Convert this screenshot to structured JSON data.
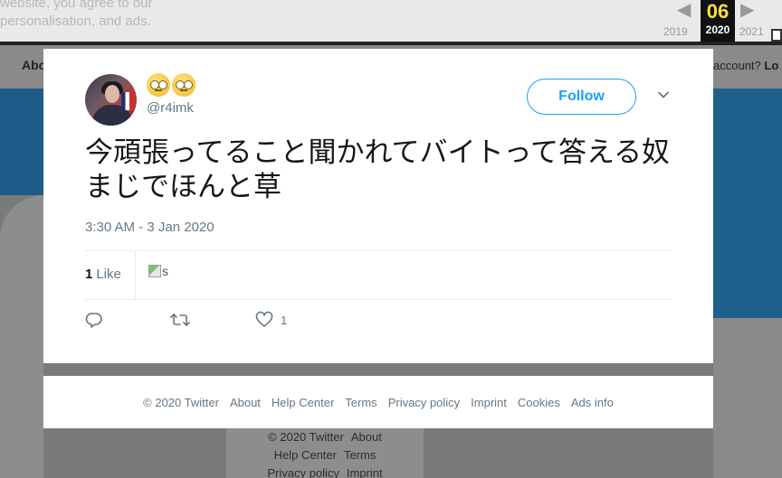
{
  "background": {
    "consent_line1": "website, you agree to our",
    "consent_line2": "personalisation, and ads.",
    "nav_about": "Abo",
    "nav_account": "account?",
    "nav_login": "Lo",
    "footer_items": [
      "© 2020 Twitter",
      "About",
      "Help Center",
      "Terms",
      "Privacy policy",
      "Imprint"
    ]
  },
  "wayback": {
    "prev_year": "2019",
    "day": "06",
    "current_year": "2020",
    "next_year": "2021"
  },
  "tweet": {
    "display_name_emoji": [
      "face-with-rolling-eyes",
      "face-with-rolling-eyes"
    ],
    "handle": "@r4imk",
    "follow_label": "Follow",
    "text": "今頑張ってること聞かれてバイトって答える奴まじでほんと草",
    "timestamp": "3:30 AM - 3 Jan 2020",
    "likes_count": "1",
    "likes_label": "Like",
    "liker_alt": "s",
    "action_like_count": "1",
    "icons": [
      "reply-icon",
      "retweet-icon",
      "heart-icon",
      "chevron-down-icon"
    ],
    "accent_color": "#1da1f2"
  },
  "footer": {
    "items": [
      "© 2020 Twitter",
      "About",
      "Help Center",
      "Terms",
      "Privacy policy",
      "Imprint",
      "Cookies",
      "Ads info"
    ]
  }
}
